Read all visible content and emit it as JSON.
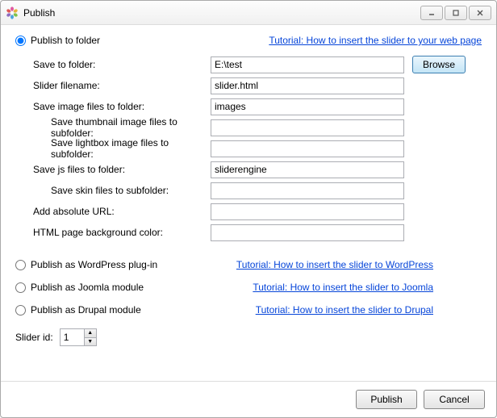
{
  "window": {
    "title": "Publish"
  },
  "top": {
    "folder_radio_label": "Publish to folder",
    "tutorial_link": "Tutorial: How to insert the slider to your web page"
  },
  "folder_form": {
    "save_to_folder_label": "Save to folder:",
    "save_to_folder_value": "E:\\test",
    "browse_label": "Browse",
    "slider_filename_label": "Slider filename:",
    "slider_filename_value": "slider.html",
    "save_image_folder_label": "Save image files to folder:",
    "save_image_folder_value": "images",
    "thumb_subfolder_label": "Save thumbnail image files to subfolder:",
    "thumb_subfolder_value": "",
    "lightbox_subfolder_label": "Save lightbox image files to subfolder:",
    "lightbox_subfolder_value": "",
    "js_folder_label": "Save js files to folder:",
    "js_folder_value": "sliderengine",
    "skin_subfolder_label": "Save skin files to subfolder:",
    "skin_subfolder_value": "",
    "abs_url_label": "Add absolute URL:",
    "abs_url_value": "",
    "bg_color_label": "HTML page background color:",
    "bg_color_value": ""
  },
  "options": {
    "wordpress_label": "Publish as WordPress plug-in",
    "wordpress_link": "Tutorial: How to insert the slider to WordPress",
    "joomla_label": "Publish as Joomla module",
    "joomla_link": "Tutorial: How to insert the slider to Joomla",
    "drupal_label": "Publish as Drupal module",
    "drupal_link": "Tutorial: How to insert the slider to Drupal"
  },
  "slider_id": {
    "label": "Slider id:",
    "value": "1"
  },
  "footer": {
    "publish": "Publish",
    "cancel": "Cancel"
  }
}
